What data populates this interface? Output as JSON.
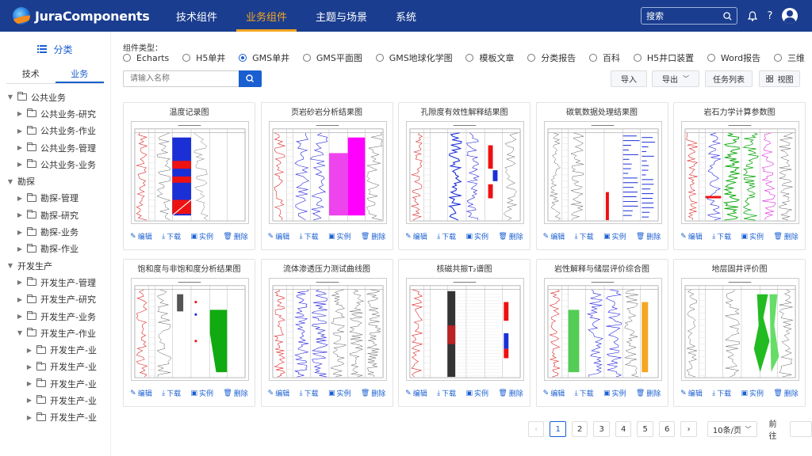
{
  "header": {
    "brand": "JuraComponents",
    "nav": [
      {
        "label": "技术组件",
        "active": false
      },
      {
        "label": "业务组件",
        "active": true
      },
      {
        "label": "主题与场景",
        "active": false
      },
      {
        "label": "系统",
        "active": false
      }
    ],
    "search_label": "搜索",
    "accent": "#f5a623",
    "bg": "#1a3d8f"
  },
  "sidebar": {
    "title": "分类",
    "tabs": [
      {
        "label": "技术",
        "active": false
      },
      {
        "label": "业务",
        "active": true
      }
    ],
    "tree": [
      {
        "label": "公共业务",
        "level": 0,
        "expanded": true,
        "folder": true
      },
      {
        "label": "公共业务-研究",
        "level": 1,
        "folder": true
      },
      {
        "label": "公共业务-作业",
        "level": 1,
        "folder": true
      },
      {
        "label": "公共业务-管理",
        "level": 1,
        "folder": true
      },
      {
        "label": "公共业务-业务",
        "level": 1,
        "folder": true
      },
      {
        "label": "勘探",
        "level": 0,
        "expanded": true,
        "folder": false
      },
      {
        "label": "勘探-管理",
        "level": 1,
        "folder": true
      },
      {
        "label": "勘探-研究",
        "level": 1,
        "folder": true
      },
      {
        "label": "勘探-业务",
        "level": 1,
        "folder": true
      },
      {
        "label": "勘探-作业",
        "level": 1,
        "folder": true
      },
      {
        "label": "开发生产",
        "level": 0,
        "expanded": true,
        "folder": false
      },
      {
        "label": "开发生产-管理",
        "level": 1,
        "folder": true
      },
      {
        "label": "开发生产-研究",
        "level": 1,
        "folder": true
      },
      {
        "label": "开发生产-业务",
        "level": 1,
        "folder": true
      },
      {
        "label": "开发生产-作业",
        "level": 1,
        "folder": true,
        "expanded": true
      },
      {
        "label": "开发生产-业",
        "level": 2,
        "folder": true
      },
      {
        "label": "开发生产-业",
        "level": 2,
        "folder": true
      },
      {
        "label": "开发生产-业",
        "level": 2,
        "folder": true
      },
      {
        "label": "开发生产-业",
        "level": 2,
        "folder": true
      },
      {
        "label": "开发生产-业",
        "level": 2,
        "folder": true
      }
    ]
  },
  "filters": {
    "type_label": "组件类型：",
    "types": [
      {
        "label": "Echarts",
        "checked": false
      },
      {
        "label": "H5单井",
        "checked": false
      },
      {
        "label": "GMS单井",
        "checked": true
      },
      {
        "label": "GMS平面图",
        "checked": false
      },
      {
        "label": "GMS地球化学图",
        "checked": false
      },
      {
        "label": "模板文章",
        "checked": false
      },
      {
        "label": "分类报告",
        "checked": false
      },
      {
        "label": "百科",
        "checked": false
      },
      {
        "label": "H5井口装置",
        "checked": false
      },
      {
        "label": "Word报告",
        "checked": false
      },
      {
        "label": "三维",
        "checked": false
      }
    ],
    "name_placeholder": "请输入名称"
  },
  "toolbar": {
    "import_label": "导入",
    "export_label": "导出",
    "tasks_label": "任务列表",
    "view_label": "视图"
  },
  "cards": [
    {
      "title": "温度记录图",
      "style": "temp"
    },
    {
      "title": "页岩砂岩分析结果图",
      "style": "magenta"
    },
    {
      "title": "孔隙度有效性解释结果图",
      "style": "porosity"
    },
    {
      "title": "碳氧数据处理结果图",
      "style": "carbon"
    },
    {
      "title": "岩石力学计算参数图",
      "style": "rock"
    },
    {
      "title": "饱和度与非饱和度分析结果图",
      "style": "saturation"
    },
    {
      "title": "流体渗透压力测试曲线图",
      "style": "fluid"
    },
    {
      "title": "核磁共振T₂谱图",
      "style": "nmr"
    },
    {
      "title": "岩性解释与储层评价综合图",
      "style": "litho"
    },
    {
      "title": "地层固井评价图",
      "style": "cement"
    }
  ],
  "card_actions": {
    "edit": "编辑",
    "download": "下载",
    "example": "实例",
    "delete": "删除"
  },
  "pager": {
    "pages": [
      "1",
      "2",
      "3",
      "4",
      "5",
      "6"
    ],
    "current": "1",
    "page_size": "10条/页",
    "goto_label": "前往"
  }
}
